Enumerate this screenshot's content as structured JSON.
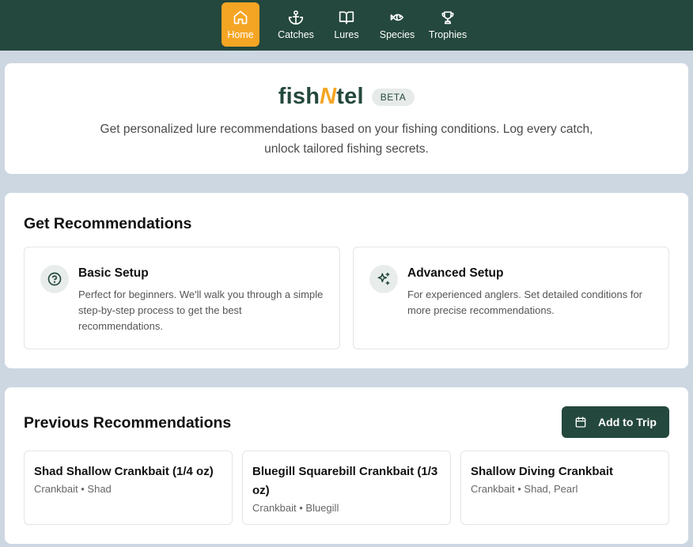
{
  "nav": {
    "items": [
      {
        "label": "Home",
        "icon": "home-icon",
        "active": true
      },
      {
        "label": "Catches",
        "icon": "anchor-icon",
        "active": false
      },
      {
        "label": "Lures",
        "icon": "book-icon",
        "active": false
      },
      {
        "label": "Species",
        "icon": "fish-icon",
        "active": false
      },
      {
        "label": "Trophies",
        "icon": "trophy-icon",
        "active": false
      }
    ]
  },
  "hero": {
    "brand_pre": "fish",
    "brand_n": "N",
    "brand_post": "tel",
    "badge": "BETA",
    "subtitle": "Get personalized lure recommendations based on your fishing conditions. Log every catch, unlock tailored fishing secrets."
  },
  "recommendations": {
    "title": "Get Recommendations",
    "basic": {
      "icon": "question-circle-icon",
      "title": "Basic Setup",
      "description": "Perfect for beginners. We'll walk you through a simple step-by-step process to get the best recommendations."
    },
    "advanced": {
      "icon": "sparkles-icon",
      "title": "Advanced Setup",
      "description": "For experienced anglers. Set detailed conditions for more precise recommendations."
    }
  },
  "previous": {
    "title": "Previous Recommendations",
    "add_button": "Add to Trip",
    "lures": [
      {
        "name": "Shad Shallow Crankbait (1/4 oz)",
        "meta": "Crankbait • Shad"
      },
      {
        "name": "Bluegill Squarebill Crankbait (1/3 oz)",
        "meta": "Crankbait • Bluegill"
      },
      {
        "name": "Shallow Diving Crankbait",
        "meta": "Crankbait • Shad, Pearl"
      }
    ]
  },
  "colors": {
    "primary": "#24483d",
    "accent": "#f5a524",
    "background": "#cdd7e1"
  }
}
